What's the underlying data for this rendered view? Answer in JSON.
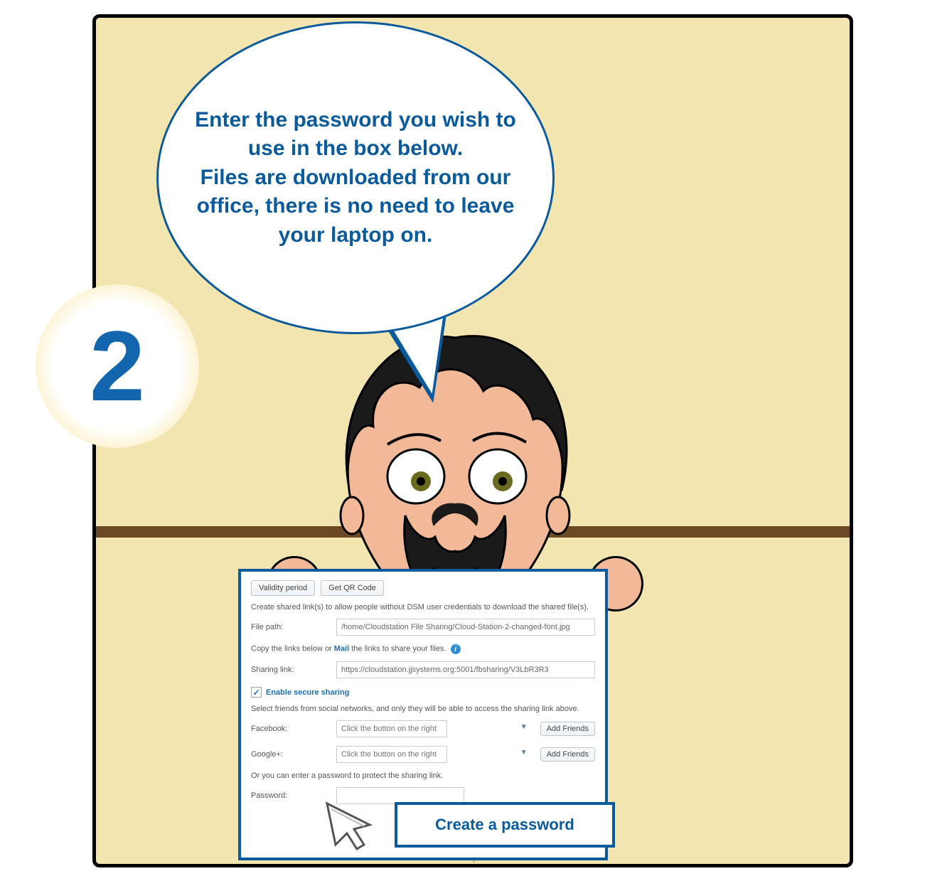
{
  "step_number": "2",
  "speech_text": "Enter the password you wish to use in the box below.\nFiles are downloaded from our office, there is no need to leave your laptop on.",
  "panel": {
    "buttons": {
      "validity": "Validity period",
      "qr": "Get QR Code"
    },
    "description": "Create shared link(s) to allow people without DSM user credentials to download the shared file(s).",
    "file_path_label": "File path:",
    "file_path_value": "/home/Cloudstation File Sharing/Cloud-Station-2-changed-font.jpg",
    "copy_line_prefix": "Copy the links below or ",
    "copy_line_mail": "Mail",
    "copy_line_suffix": " the links to share your files.",
    "sharing_link_label": "Sharing link:",
    "sharing_link_value": "https://cloudstation.jjsystems.org:5001/fbsharing/V3LbR3R3",
    "secure_checkbox_label": "Enable secure sharing",
    "secure_checked": true,
    "friends_line": "Select friends from social networks, and only they will be able to access the sharing link above.",
    "social": [
      {
        "label": "Facebook:",
        "placeholder": "Click the button on the right",
        "button": "Add Friends"
      },
      {
        "label": "Google+:",
        "placeholder": "Click the button on the right",
        "button": "Add Friends"
      }
    ],
    "password_intro": "Or you can enter a password to protect the sharing link.",
    "password_label": "Password:"
  },
  "callout_label": "Create a password"
}
